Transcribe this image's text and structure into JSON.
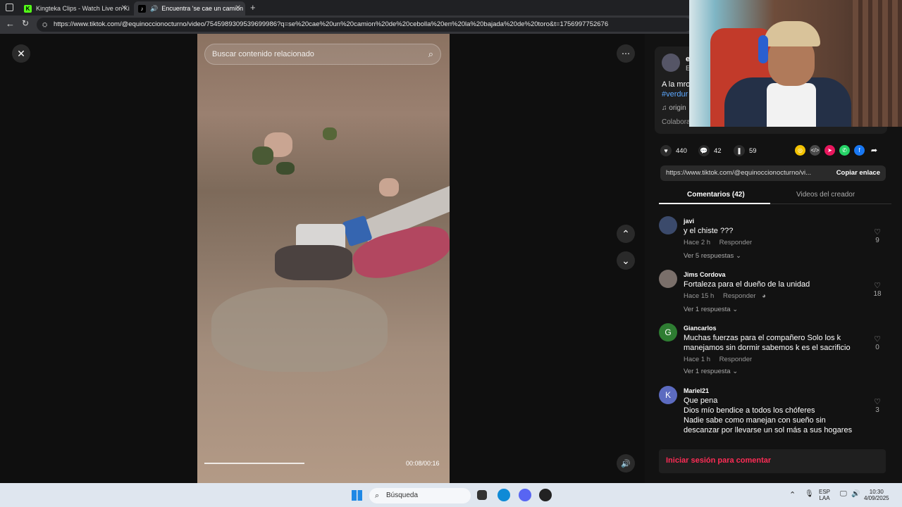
{
  "browser": {
    "tabs": [
      {
        "label": "Kingteka Clips - Watch Live on Ki"
      },
      {
        "label": "Encuentra 'se cae un camion"
      }
    ],
    "url": "https://www.tiktok.com/@equinoccionocturno/video/7545989309539699986?q=se%20cae%20un%20camion%20de%20cebolla%20en%20la%20bajada%20de%20toro&t=1756997752676"
  },
  "video": {
    "search_placeholder": "Buscar contenido relacionado",
    "timecode": "00:08/00:16",
    "progress_fraction": 0.42
  },
  "creator": {
    "initial": "e",
    "handle_fragment": "E",
    "desc_fragment": "A la mro",
    "tag_fragment": "#verdur",
    "music_fragment": "origin",
    "collab_fragment": "Colabora"
  },
  "stats": {
    "likes": "440",
    "comments": "42",
    "saves": "59"
  },
  "share_colors": [
    "#f2c200",
    "#4a4a4a",
    "#e8175d",
    "#25d366",
    "#1877f2"
  ],
  "link": {
    "text": "https://www.tiktok.com/@equinoccionocturno/vi...",
    "copy_label": "Copiar enlace"
  },
  "panel_tabs": {
    "comments": "Comentarios (42)",
    "creator_videos": "Videos del creador"
  },
  "comments": [
    {
      "name": "javi",
      "text": "y el chiste ???",
      "time": "Hace 2 h",
      "reply": "Responder",
      "replies": "Ver 5 respuestas",
      "likes": "9",
      "avatar": "",
      "avatar_color": "#3b4a6b"
    },
    {
      "name": "Jims Cordova",
      "text": "Fortaleza para el dueño de la unidad",
      "time": "Hace 15 h",
      "reply": "Responder",
      "replies": "Ver 1 respuesta",
      "likes": "18",
      "avatar": "",
      "avatar_color": "#7a6f6a"
    },
    {
      "name": "Giancarlos",
      "text": "Muchas fuerzas para el compañero Solo los k manejamos sin dormir sabemos k es el sacrificio",
      "time": "Hace 1 h",
      "reply": "Responder",
      "replies": "Ver 1 respuesta",
      "likes": "0",
      "avatar": "G",
      "avatar_color": "#2e7d32"
    },
    {
      "name": "Mariel21",
      "text": "Que pena\nDios mío bendice a todos los chóferes\nNadie sabe como manejan con sueño sin descanzar por llevarse un sol más a sus hogares",
      "time": "",
      "reply": "",
      "replies": "",
      "likes": "3",
      "avatar": "K",
      "avatar_color": "#5c6bc0"
    }
  ],
  "login": {
    "label": "Iniciar sesión para comentar"
  },
  "taskbar": {
    "search": "Búsqueda",
    "lang": "ESP",
    "lang2": "LAA",
    "time": "10:30",
    "date": "4/09/2025"
  }
}
